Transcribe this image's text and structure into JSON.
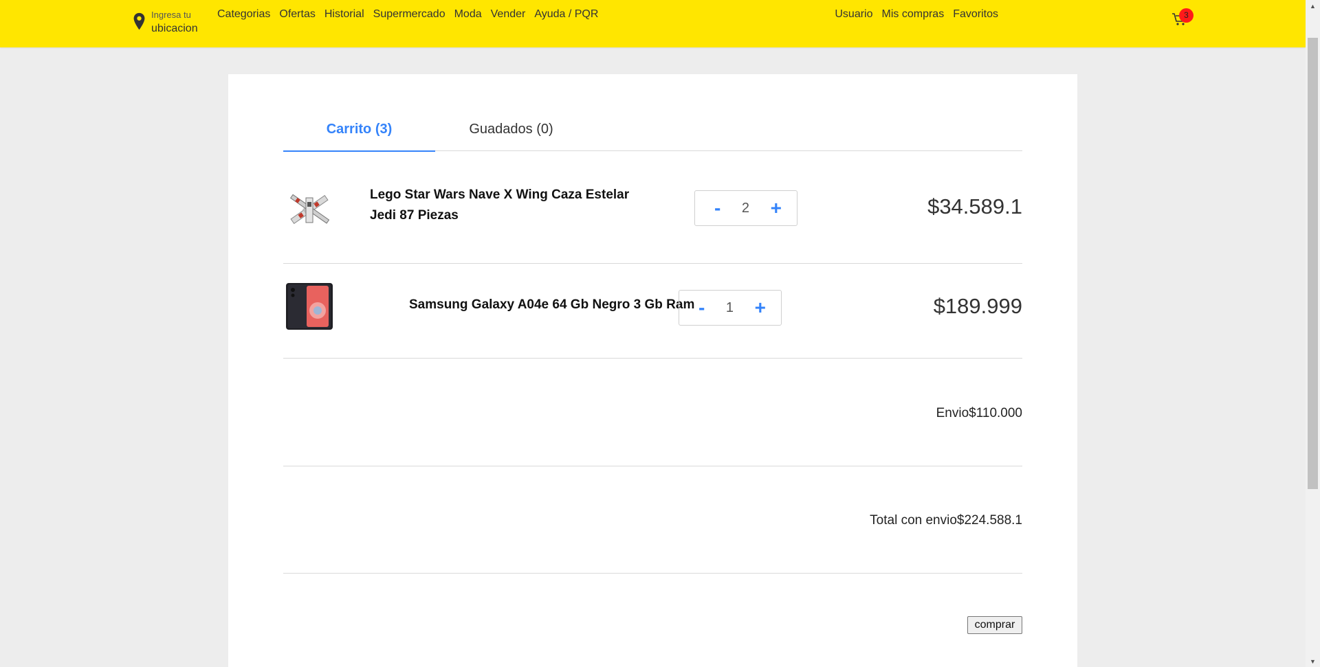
{
  "header": {
    "location_small": "Ingresa tu",
    "location_big": "ubicacion",
    "nav": [
      "Categorias",
      "Ofertas",
      "Historial",
      "Supermercado",
      "Moda",
      "Vender",
      "Ayuda / PQR"
    ],
    "user_nav": [
      "Usuario",
      "Mis compras",
      "Favoritos"
    ],
    "cart_count": "3"
  },
  "tabs": {
    "cart": "Carrito (3)",
    "saved": "Guadados (0)"
  },
  "items": [
    {
      "title": "Lego Star Wars Nave X Wing Caza Estelar Jedi 87 Piezas",
      "qty": "2",
      "price": "$34.589.1",
      "image": "x-wing-lego-image"
    },
    {
      "title": "Samsung Galaxy A04e 64 Gb Negro 3 Gb Ram",
      "qty": "1",
      "price": "$189.999",
      "image": "samsung-phone-image"
    }
  ],
  "qty_controls": {
    "minus": "-",
    "plus": "+"
  },
  "summary": {
    "shipping": "Envio$110.000",
    "total": "Total con envio$224.588.1"
  },
  "buy_button": "comprar",
  "colors": {
    "header_bg": "#ffe600",
    "accent": "#3483fa",
    "badge": "#ff1a1a"
  }
}
